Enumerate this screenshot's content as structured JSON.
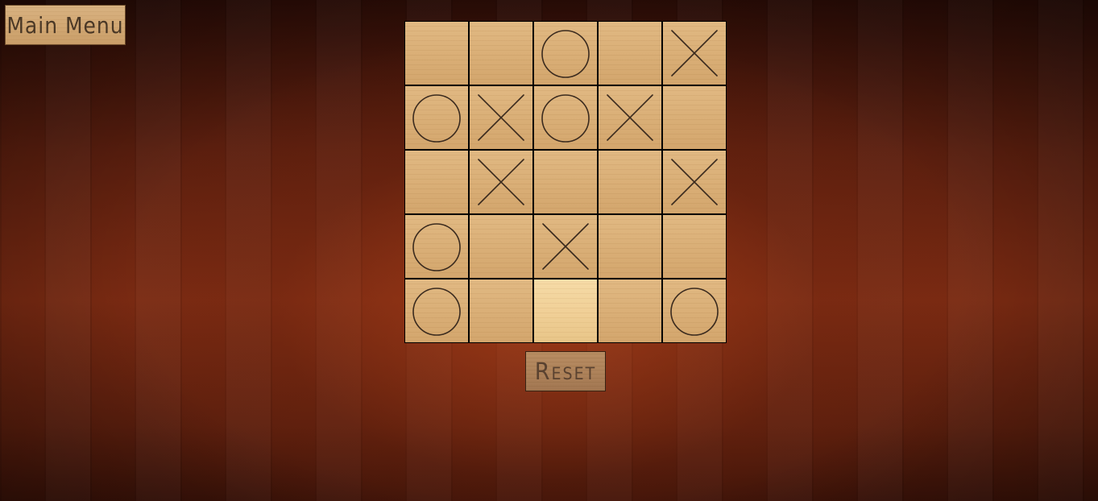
{
  "menu": {
    "main_menu_label": "Main Menu"
  },
  "game": {
    "reset_label": "Reset",
    "board_size": 5,
    "board": [
      [
        "",
        "",
        "O",
        "",
        "X"
      ],
      [
        "O",
        "X",
        "O",
        "X",
        ""
      ],
      [
        "",
        "X",
        "",
        "",
        "X"
      ],
      [
        "O",
        "",
        "X",
        "",
        ""
      ],
      [
        "O",
        "",
        "",
        "",
        "O"
      ]
    ],
    "highlighted_cell": {
      "row": 4,
      "col": 2
    }
  },
  "colors": {
    "mark_stroke": "#3a2a1e"
  }
}
